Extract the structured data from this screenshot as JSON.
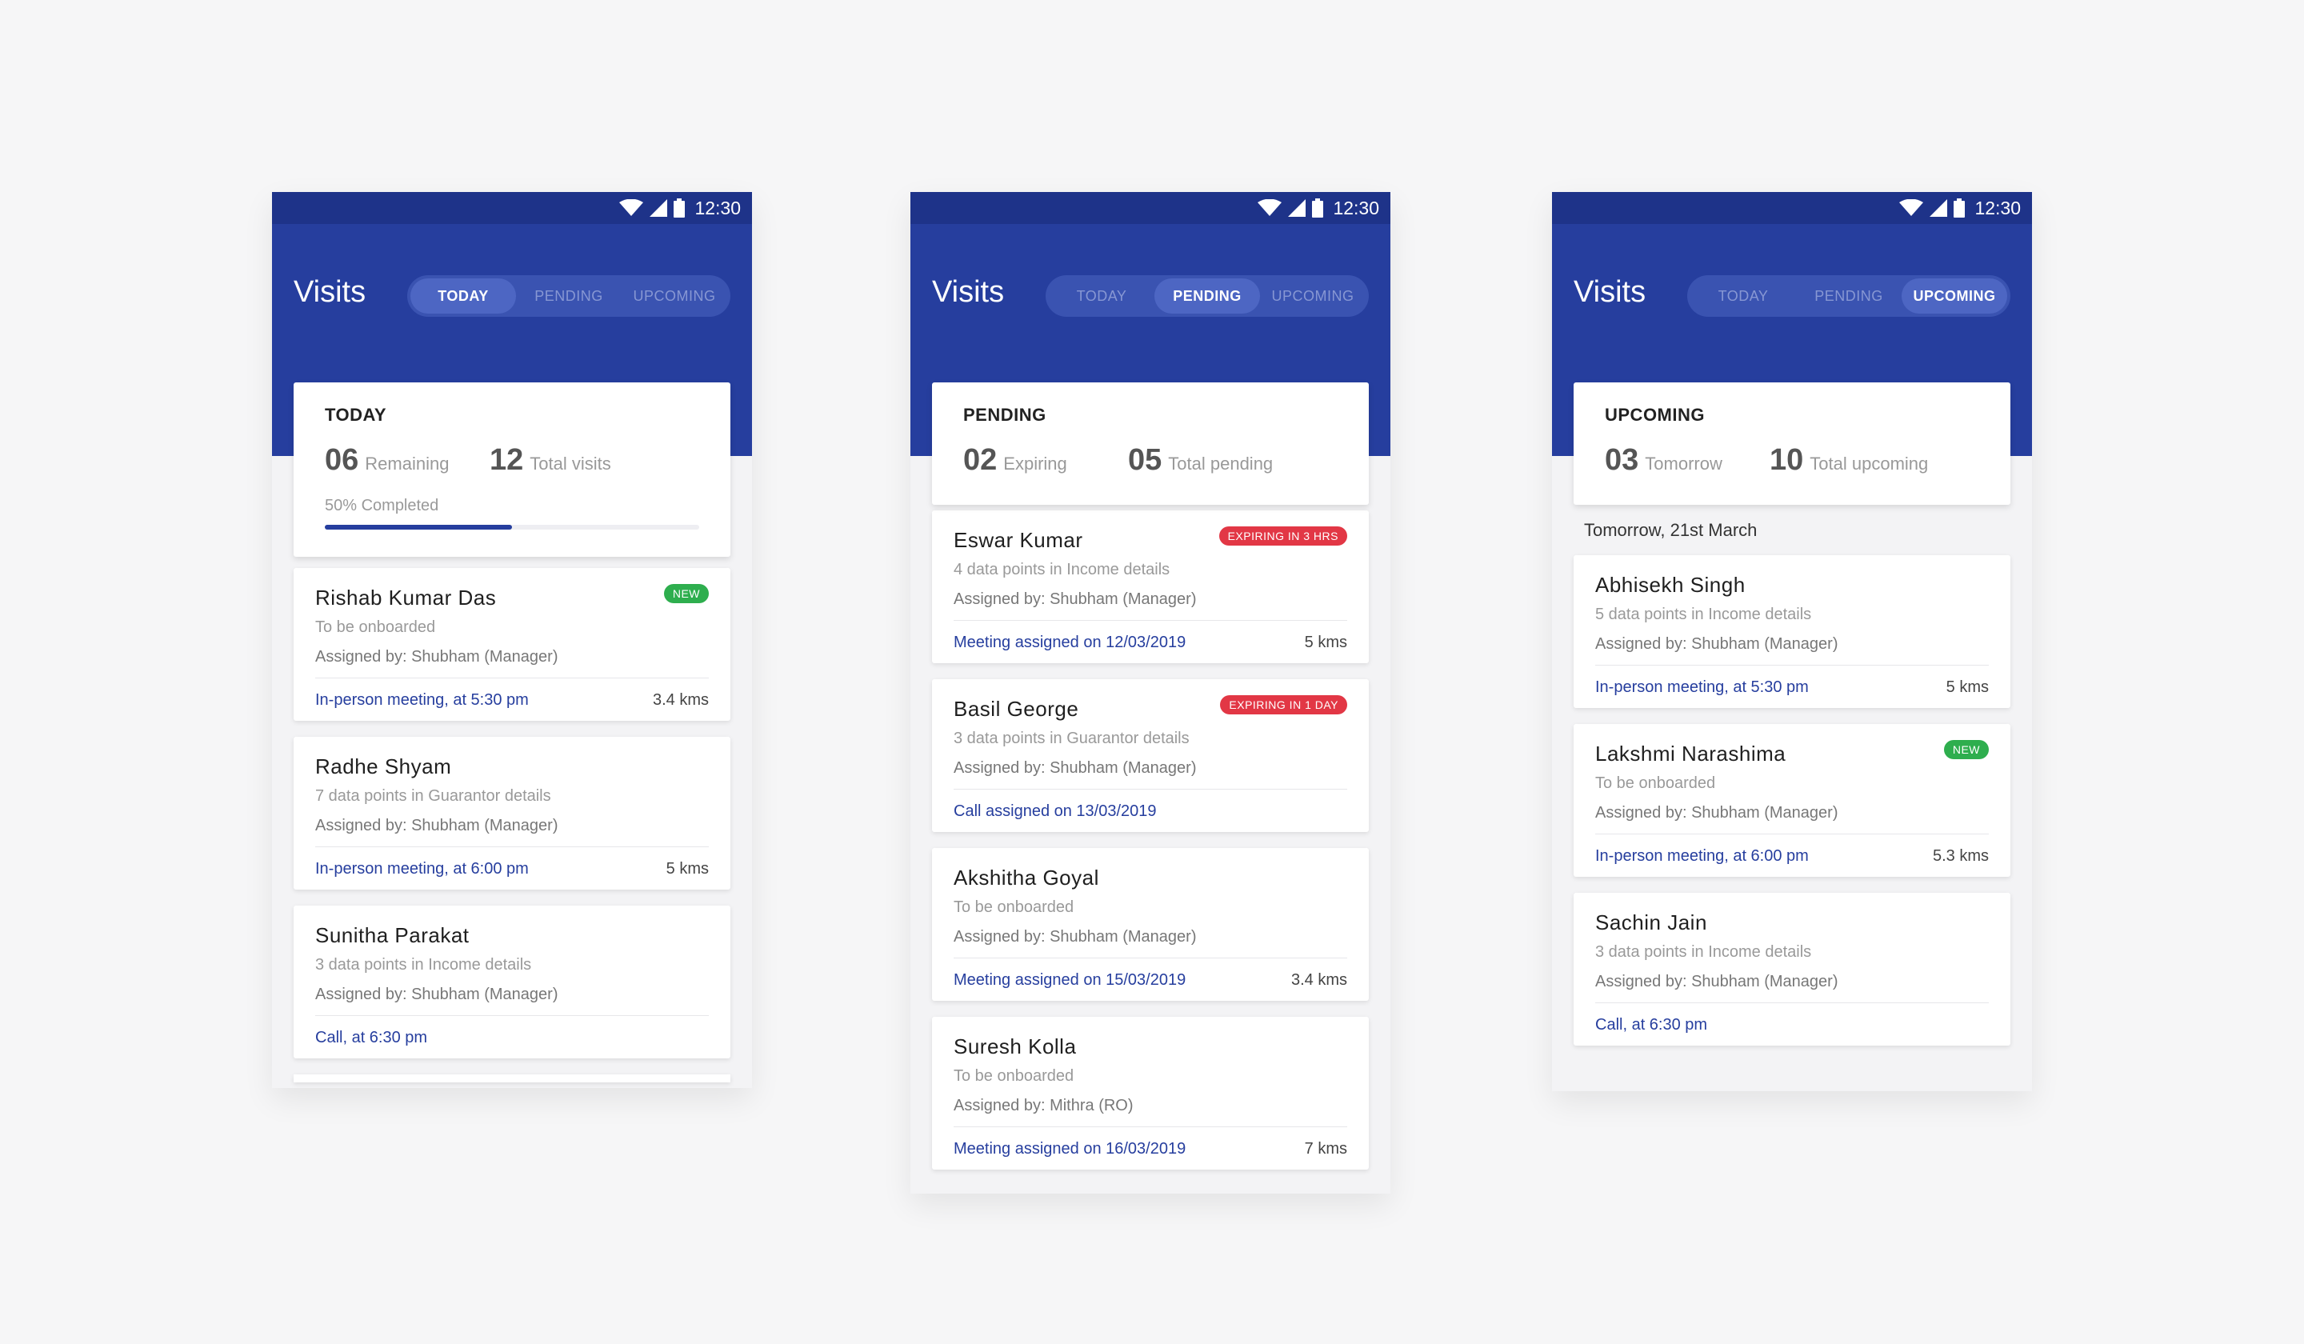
{
  "colors": {
    "status_bar": "#1e3389",
    "app_bar": "#263e9e",
    "accent": "#263e9e",
    "new_badge": "#2eae4e",
    "expiring_badge": "#e23745"
  },
  "screens": [
    {
      "status": {
        "time": "12:30",
        "icons": [
          "wifi-icon",
          "signal-icon",
          "battery-icon"
        ]
      },
      "title": "Visits",
      "tabs": [
        {
          "label": "TODAY",
          "active": true
        },
        {
          "label": "PENDING",
          "active": false
        },
        {
          "label": "UPCOMING",
          "active": false
        }
      ],
      "summary": {
        "title": "TODAY",
        "stat1": {
          "value": "06",
          "label": "Remaining"
        },
        "stat2": {
          "value": "12",
          "label": "Total visits"
        },
        "progress_label": "50% Completed",
        "progress": 0.5
      },
      "section_date": "",
      "cards": [
        {
          "name": "Rishab Kumar Das",
          "badge": "NEW",
          "badge_type": "new",
          "sub": "To be onboarded",
          "assigned": "Assigned by: Shubham (Manager)",
          "meeting": "In-person meeting, at 5:30 pm",
          "distance": "3.4 kms"
        },
        {
          "name": "Radhe Shyam",
          "badge": "",
          "badge_type": "",
          "sub": "7 data points in Guarantor details",
          "assigned": "Assigned by: Shubham (Manager)",
          "meeting": "In-person meeting, at 6:00 pm",
          "distance": "5 kms"
        },
        {
          "name": "Sunitha Parakat",
          "badge": "",
          "badge_type": "",
          "sub": "3 data points in Income details",
          "assigned": "Assigned by: Shubham (Manager)",
          "meeting": "Call, at 6:30 pm",
          "distance": ""
        }
      ]
    },
    {
      "status": {
        "time": "12:30",
        "icons": [
          "wifi-icon",
          "signal-icon",
          "battery-icon"
        ]
      },
      "title": "Visits",
      "tabs": [
        {
          "label": "TODAY",
          "active": false
        },
        {
          "label": "PENDING",
          "active": true
        },
        {
          "label": "UPCOMING",
          "active": false
        }
      ],
      "summary": {
        "title": "PENDING",
        "stat1": {
          "value": "02",
          "label": "Expiring"
        },
        "stat2": {
          "value": "05",
          "label": "Total pending"
        },
        "progress_label": "",
        "progress": null
      },
      "section_date": "",
      "cards": [
        {
          "name": "Eswar Kumar",
          "badge": "EXPIRING IN 3 HRS",
          "badge_type": "exp",
          "sub": "4 data points in Income details",
          "assigned": "Assigned by: Shubham (Manager)",
          "meeting": "Meeting assigned on 12/03/2019",
          "distance": "5 kms"
        },
        {
          "name": "Basil George",
          "badge": "EXPIRING IN 1 DAY",
          "badge_type": "exp",
          "sub": "3 data points in Guarantor details",
          "assigned": "Assigned by: Shubham (Manager)",
          "meeting": "Call assigned on 13/03/2019",
          "distance": ""
        },
        {
          "name": "Akshitha Goyal",
          "badge": "",
          "badge_type": "",
          "sub": "To be onboarded",
          "assigned": "Assigned by: Shubham (Manager)",
          "meeting": "Meeting assigned on 15/03/2019",
          "distance": "3.4 kms"
        },
        {
          "name": "Suresh Kolla",
          "badge": "",
          "badge_type": "",
          "sub": "To be onboarded",
          "assigned": "Assigned by: Mithra (RO)",
          "meeting": "Meeting assigned on 16/03/2019",
          "distance": "7 kms"
        }
      ]
    },
    {
      "status": {
        "time": "12:30",
        "icons": [
          "wifi-icon",
          "signal-icon",
          "battery-icon"
        ]
      },
      "title": "Visits",
      "tabs": [
        {
          "label": "TODAY",
          "active": false
        },
        {
          "label": "PENDING",
          "active": false
        },
        {
          "label": "UPCOMING",
          "active": true
        }
      ],
      "summary": {
        "title": "UPCOMING",
        "stat1": {
          "value": "03",
          "label": "Tomorrow"
        },
        "stat2": {
          "value": "10",
          "label": "Total upcoming"
        },
        "progress_label": "",
        "progress": null
      },
      "section_date": "Tomorrow, 21st March",
      "cards": [
        {
          "name": "Abhisekh Singh",
          "badge": "",
          "badge_type": "",
          "sub": "5 data points in Income details",
          "assigned": "Assigned by: Shubham (Manager)",
          "meeting": "In-person meeting, at 5:30 pm",
          "distance": "5 kms"
        },
        {
          "name": "Lakshmi Narashima",
          "badge": "NEW",
          "badge_type": "new",
          "sub": "To be onboarded",
          "assigned": "Assigned by: Shubham (Manager)",
          "meeting": "In-person meeting, at 6:00 pm",
          "distance": "5.3 kms"
        },
        {
          "name": "Sachin Jain",
          "badge": "",
          "badge_type": "",
          "sub": "3 data points in Income details",
          "assigned": "Assigned by: Shubham (Manager)",
          "meeting": "Call, at 6:30 pm",
          "distance": ""
        }
      ]
    }
  ]
}
